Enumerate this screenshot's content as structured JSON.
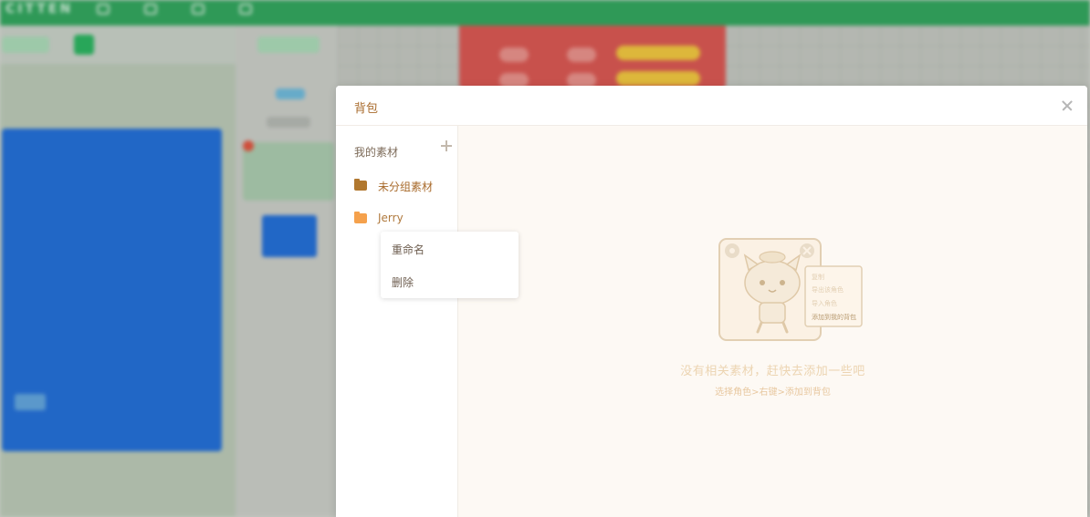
{
  "app": {
    "logo_text": "CITTEN"
  },
  "modal": {
    "title": "背包"
  },
  "sidebar": {
    "header_label": "我的素材",
    "groups": [
      {
        "label": "未分组素材",
        "folder_color": "#b1782f"
      },
      {
        "label": "Jerry",
        "folder_color": "#f5a14c"
      }
    ]
  },
  "context_menu": {
    "items": [
      {
        "label": "重命名"
      },
      {
        "label": "删除"
      }
    ]
  },
  "empty_state": {
    "title": "没有相关素材，赶快去添加一些吧",
    "hint": "选择角色>右键>添加到背包",
    "illustration_menu": [
      "复制",
      "导出该角色",
      "导入角色",
      "添加到我的背包"
    ]
  },
  "colors": {
    "accent": "#a86a2b",
    "app_bar": "#2ea35b",
    "content_bg": "#fdf9f4"
  }
}
